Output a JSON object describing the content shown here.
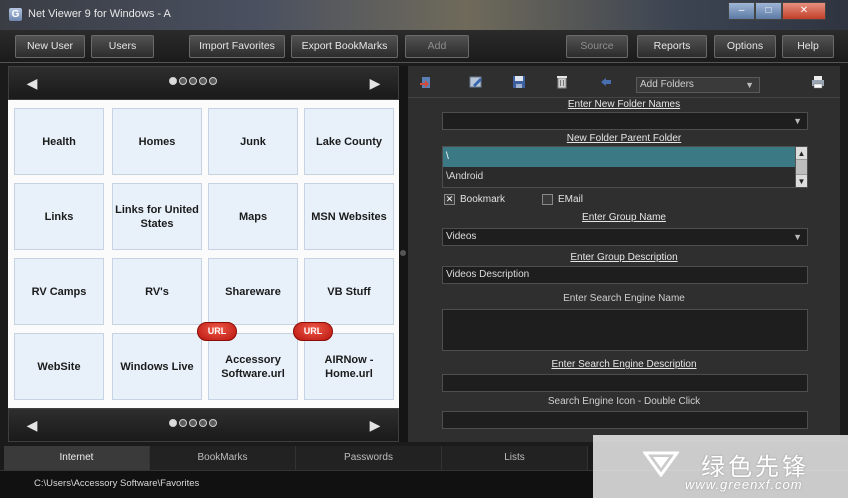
{
  "window": {
    "title": "Net Viewer 9 for Windows - A",
    "controls": [
      "–",
      "□",
      "✕"
    ]
  },
  "menubar": {
    "new_user": "New User",
    "users": "Users",
    "import_favorites": "Import Favorites",
    "export_bookmarks": "Export BookMarks",
    "add": "Add",
    "source": "Source",
    "reports": "Reports",
    "options": "Options",
    "help": "Help"
  },
  "left_panel": {
    "prev_arrow": "◀",
    "next_arrow": "▶",
    "tiles": [
      {
        "label": "Health"
      },
      {
        "label": "Homes"
      },
      {
        "label": "Junk"
      },
      {
        "label": "Lake County"
      },
      {
        "label": "Links"
      },
      {
        "label": "Links for United States"
      },
      {
        "label": "Maps"
      },
      {
        "label": "MSN Websites"
      },
      {
        "label": "RV Camps"
      },
      {
        "label": "RV's"
      },
      {
        "label": "Shareware"
      },
      {
        "label": "VB Stuff"
      },
      {
        "label": "WebSite"
      },
      {
        "label": "Windows Live"
      },
      {
        "label": "Accessory Software.url",
        "badge": "URL"
      },
      {
        "label": "AIRNow - Home.url",
        "badge": "URL"
      }
    ]
  },
  "right_panel": {
    "add_folders_select": "Add Folders",
    "enter_folder_names_label": "Enter New Folder Names",
    "folder_names_value": "",
    "parent_folder_label": "New Folder Parent Folder",
    "parent_folder_items": [
      "\\",
      "\\Android"
    ],
    "bookmark_checkbox": {
      "label": "Bookmark",
      "checked": true
    },
    "email_checkbox": {
      "label": "EMail",
      "checked": false
    },
    "group_name_label": "Enter Group Name",
    "group_name_value": "Videos",
    "group_description_label": "Enter Group Description",
    "group_description_value": "Videos Description",
    "search_engine_name_label": "Enter Search Engine Name",
    "search_engine_name_value": "",
    "search_engine_description_label": "Enter Search Engine Description",
    "search_engine_description_value": "",
    "search_engine_icon_label": "Search Engine Icon - Double Click",
    "search_engine_icon_value": ""
  },
  "tabs": [
    "Internet",
    "BookMarks",
    "Passwords",
    "Lists"
  ],
  "status_bar": {
    "path": "C:\\Users\\Accessory Software\\Favorites"
  },
  "watermark": {
    "chinese": "绿色先锋",
    "url": "www.greenxf.com"
  },
  "colors": {
    "tile_background": "#e8f1fa",
    "url_badge": "#d0241a",
    "selected_row": "#3b7a84",
    "dark_chrome": "#1b1b1b"
  }
}
